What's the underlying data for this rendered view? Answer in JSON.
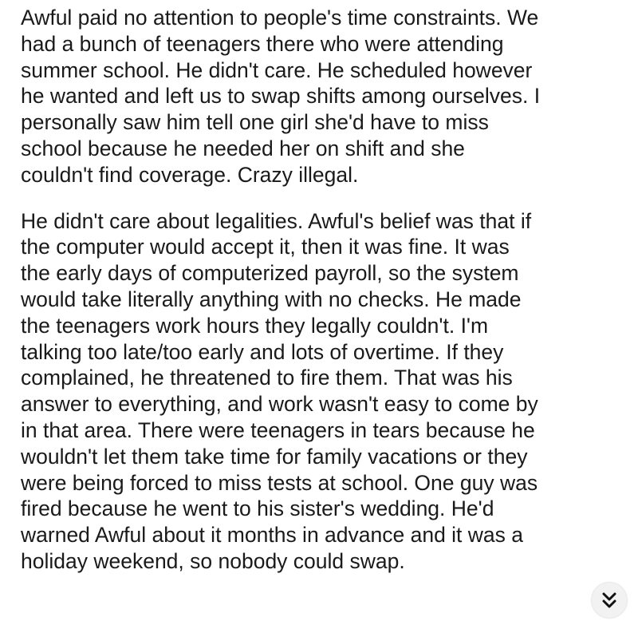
{
  "paragraphs": [
    {
      "lines": [
        "Awful paid no attention to people's time constraints. We",
        "had a bunch of teenagers there who were attending",
        "summer school. He didn't care. He scheduled however",
        "he wanted and left us to swap shifts among ourselves. I",
        "personally saw him tell one girl she'd have to miss",
        "school because he needed her on shift and she",
        "couldn't find coverage. Crazy illegal."
      ]
    },
    {
      "lines": [
        "He didn't care about legalities. Awful's belief was that if",
        "the computer would accept it, then it was fine. It was",
        "the early days of computerized payroll, so the system",
        "would take literally anything with no checks. He made",
        "the teenagers work hours they legally couldn't. I'm",
        "talking too late/too early and lots of overtime. If they",
        "complained, he threatened to fire them. That was his",
        "answer to everything, and work wasn't easy to come by",
        "in that area. There were teenagers in tears because he",
        "wouldn't let them take time for family vacations or they",
        "were being forced to miss tests at school. One guy was",
        "fired because he went to his sister's wedding. He'd",
        "warned Awful about it months in advance and it was a",
        "holiday weekend, so nobody could swap."
      ]
    }
  ],
  "scroll_button": {
    "icon": "double-chevron-down-icon"
  }
}
